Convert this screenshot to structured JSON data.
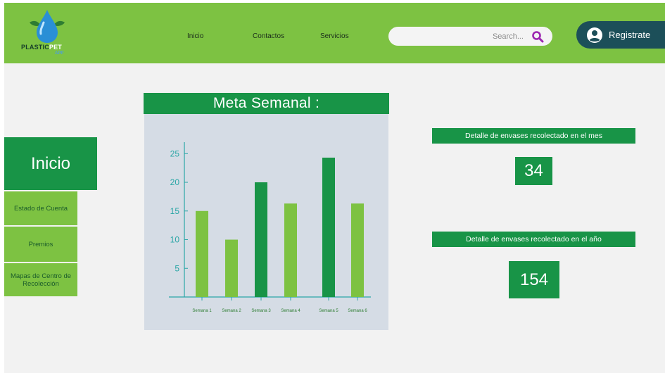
{
  "brand": {
    "logo_main": "PLASTIC",
    "logo_accent": "PET",
    "logo_sub": "APP"
  },
  "nav": {
    "home": "Inicio",
    "contacts": "Contactos",
    "services": "Servicios"
  },
  "search": {
    "placeholder": "Search..."
  },
  "register": {
    "label": "Registrate"
  },
  "sidebar": {
    "main": "Inicio",
    "items": [
      {
        "label": "Estado de Cuenta"
      },
      {
        "label": "Premios"
      },
      {
        "label": "Mapas de Centro de Recolección"
      }
    ]
  },
  "chart_title": "Meta Semanal :",
  "chart_data": {
    "type": "bar",
    "title": "Meta Semanal :",
    "categories": [
      "Semana 1",
      "Semana 2",
      "Semana 3",
      "Semana 4",
      "Semana 5",
      "Semana 6"
    ],
    "values": [
      15,
      10,
      20,
      16.3,
      24.3,
      16.3
    ],
    "bar_colors": [
      "#7dc242",
      "#7dc242",
      "#189447",
      "#7dc242",
      "#189447",
      "#7dc242"
    ],
    "yticks": [
      5,
      10,
      15,
      20,
      25
    ],
    "ylim": [
      0,
      27
    ],
    "xlabel": "",
    "ylabel": "",
    "grid": false,
    "axis_color": "#2aa6a6"
  },
  "stats": {
    "monthly": {
      "title": "Detalle de envases recolectado en el mes",
      "value": "34"
    },
    "yearly": {
      "title": "Detalle de envases recolectado en el año",
      "value": "154"
    }
  },
  "colors": {
    "header": "#7dc242",
    "primary_green": "#189447",
    "light_green": "#7dc242",
    "register_bg": "#1c4f59",
    "search_icon": "#9c27b0"
  }
}
